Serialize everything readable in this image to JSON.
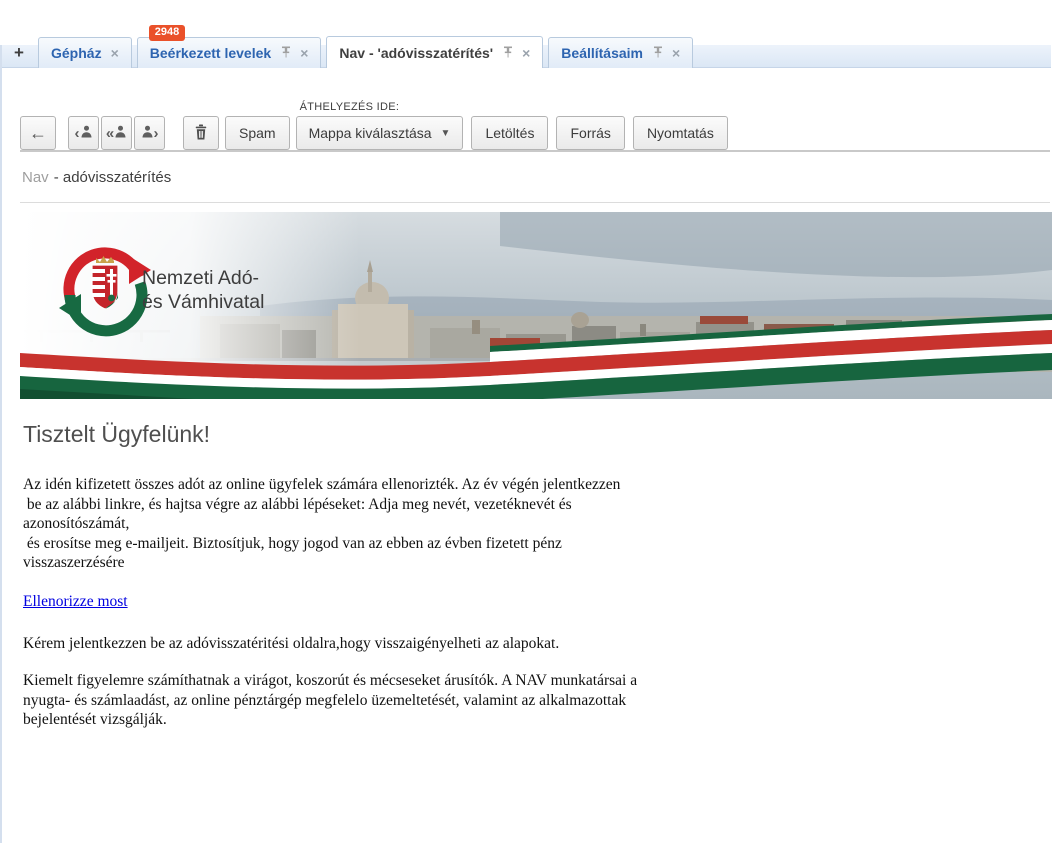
{
  "tabs": {
    "new_tab_label": "+",
    "close_glyph": "×",
    "items": [
      {
        "label": "Gépház",
        "active": false
      },
      {
        "label": "Beérkezett levelek",
        "badge": "2948",
        "active": false
      },
      {
        "label": "Nav - 'adóvisszatérítés'",
        "active": true
      },
      {
        "label": "Beállításaim",
        "active": false
      }
    ]
  },
  "toolbar": {
    "back_glyph": "←",
    "reply_glyph": "‹",
    "reply_all_glyph": "«",
    "forward_glyph": "›",
    "spam_label": "Spam",
    "move_here_label": "ÁTHELYEZÉS IDE:",
    "folder_select_label": "Mappa kiválasztása",
    "dropdown_arrow": "▼",
    "download_label": "Letöltés",
    "source_label": "Forrás",
    "print_label": "Nyomtatás"
  },
  "message": {
    "subject_prefix": "Nav",
    "subject_text": "- adóvisszatérítés"
  },
  "banner": {
    "org_name_line1": "Nemzeti Adó-",
    "org_name_line2": "és Vámhivatal"
  },
  "email": {
    "greeting": "Tisztelt Ügyfelünk!",
    "paragraph1": "Az idén kifizetett összes adót az online ügyfelek számára ellenorizték. Az év végén jelentkezzen\n be az alábbi linkre, és hajtsa végre az alábbi lépéseket: Adja meg nevét, vezetéknevét és\nazonosítószámát,\n és erosítse meg e-mailjeit. Biztosítjuk, hogy jogod van az ebben az évben fizetett pénz\nvisszaszerzésére",
    "link_label": "Ellenorizze most",
    "paragraph2": "Kérem jelentkezzen be az adóvisszatéritési oldalra,hogy visszaigényelheti az alapokat.",
    "paragraph3": "Kiemelt figyelemre számíthatnak a virágot, koszorút és mécseseket árusítók. A NAV munkatársai a\nnyugta- és számlaadást, az online pénztárgép megfelelo üzemeltetését, valamint az alkalmazottak\nbejelentését vizsgálják."
  },
  "colors": {
    "badge_bg": "#ea512a",
    "tab_text_blue": "#2d64b0",
    "link_blue": "#0000e0",
    "flag_red": "#c8332e",
    "flag_green": "#17653f"
  }
}
